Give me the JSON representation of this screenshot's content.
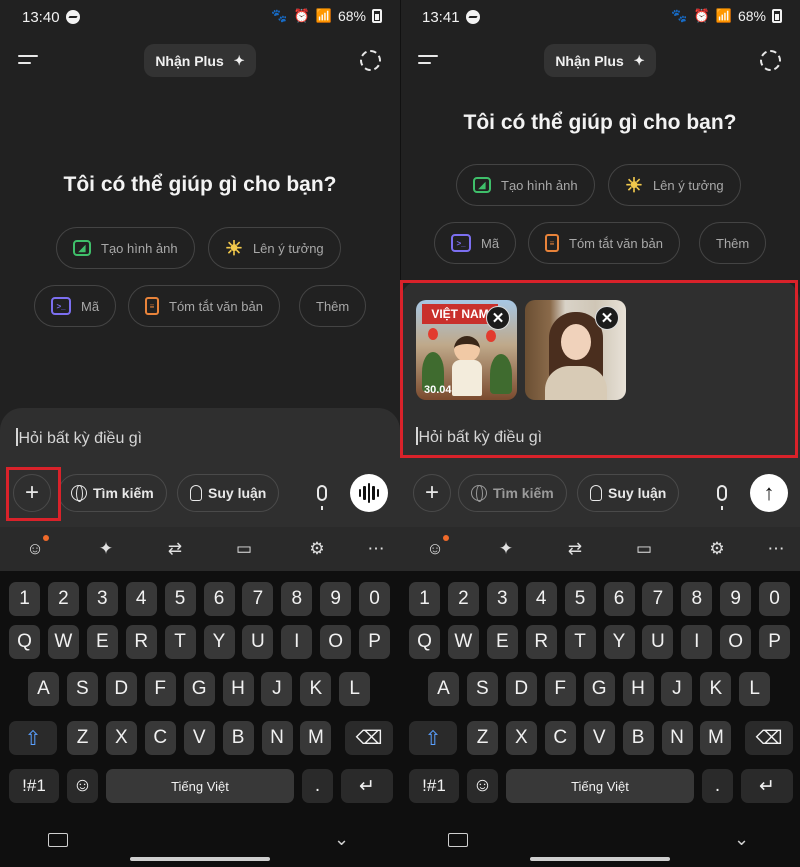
{
  "panels": [
    {
      "status": {
        "time": "13:40",
        "battery": "68%"
      },
      "header": {
        "upgrade_label": "Nhận Plus"
      },
      "greeting": "Tôi có thể giúp gì cho bạn?",
      "chips": [
        "Tạo hình ảnh",
        "Lên ý tưởng",
        "Mã",
        "Tóm tắt văn bản",
        "Thêm"
      ],
      "composer": {
        "placeholder": "Hỏi bất kỳ điều gì"
      },
      "tools": {
        "search": "Tìm kiếm",
        "reason": "Suy luận"
      },
      "keyboard": {
        "space_label": "Tiếng Việt"
      }
    },
    {
      "status": {
        "time": "13:41",
        "battery": "68%"
      },
      "header": {
        "upgrade_label": "Nhận Plus"
      },
      "greeting": "Tôi có thể giúp gì cho bạn?",
      "chips": [
        "Tạo hình ảnh",
        "Lên ý tưởng",
        "Mã",
        "Tóm tắt văn bản",
        "Thêm"
      ],
      "attachments": [
        {
          "banner": "VIỆT NAM",
          "date": "30.04"
        },
        {}
      ],
      "composer": {
        "placeholder": "Hỏi bất kỳ điều gì"
      },
      "tools": {
        "search": "Tìm kiếm",
        "reason": "Suy luận"
      },
      "keyboard": {
        "space_label": "Tiếng Việt"
      }
    }
  ],
  "keyboard_rows": {
    "numbers": [
      "1",
      "2",
      "3",
      "4",
      "5",
      "6",
      "7",
      "8",
      "9",
      "0"
    ],
    "row1": [
      "Q",
      "W",
      "E",
      "R",
      "T",
      "Y",
      "U",
      "I",
      "O",
      "P"
    ],
    "row2": [
      "A",
      "S",
      "D",
      "F",
      "G",
      "H",
      "J",
      "K",
      "L"
    ],
    "row3": [
      "Z",
      "X",
      "C",
      "V",
      "B",
      "N",
      "M"
    ],
    "symbols_key": "!#1",
    "period_key": "."
  },
  "icons": {
    "menu": "menu-icon",
    "sparkle": "sparkle-icon",
    "temp_chat": "temporary-chat-icon",
    "image": "image-icon",
    "idea": "lightbulb-icon",
    "code": "code-icon",
    "doc": "document-icon",
    "plus": "plus-icon",
    "globe": "globe-icon",
    "mic": "microphone-icon",
    "voice": "voice-mode-icon",
    "send": "send-arrow-icon",
    "close": "close-icon"
  },
  "colors": {
    "highlight": "#d9222a",
    "image_icon": "#3fbf6a",
    "idea_icon": "#f2c94c",
    "code_icon": "#7c6ff0",
    "doc_icon": "#e8833a",
    "notification_dot": "#f06a2a"
  }
}
